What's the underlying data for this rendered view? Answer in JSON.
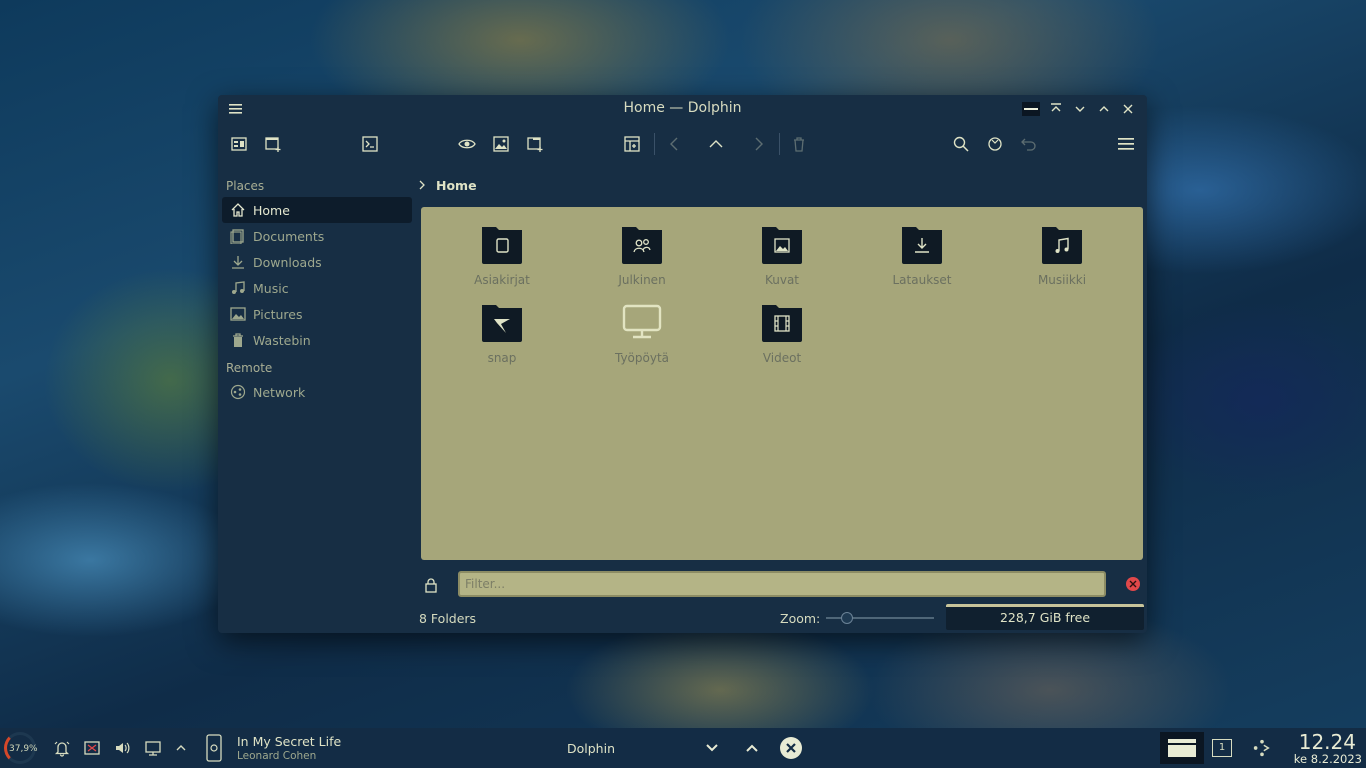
{
  "window": {
    "title": "Home — Dolphin"
  },
  "sidebar": {
    "places_title": "Places",
    "remote_title": "Remote",
    "places": [
      {
        "label": "Home",
        "icon": "home-icon"
      },
      {
        "label": "Documents",
        "icon": "documents-icon"
      },
      {
        "label": "Downloads",
        "icon": "downloads-icon"
      },
      {
        "label": "Music",
        "icon": "music-icon"
      },
      {
        "label": "Pictures",
        "icon": "pictures-icon"
      },
      {
        "label": "Wastebin",
        "icon": "trash-icon"
      }
    ],
    "remote": [
      {
        "label": "Network",
        "icon": "network-icon"
      }
    ]
  },
  "breadcrumb": {
    "current": "Home"
  },
  "folders": [
    {
      "label": "Asiakirjat",
      "icon": "documents-folder-icon"
    },
    {
      "label": "Julkinen",
      "icon": "public-folder-icon"
    },
    {
      "label": "Kuvat",
      "icon": "pictures-folder-icon"
    },
    {
      "label": "Lataukset",
      "icon": "downloads-folder-icon"
    },
    {
      "label": "Musiikki",
      "icon": "music-folder-icon"
    },
    {
      "label": "snap",
      "icon": "snap-folder-icon"
    },
    {
      "label": "Työpöytä",
      "icon": "desktop-folder-icon"
    },
    {
      "label": "Videot",
      "icon": "videos-folder-icon"
    }
  ],
  "filter": {
    "placeholder": "Filter..."
  },
  "statusbar": {
    "summary": "8 Folders",
    "zoom_label": "Zoom:",
    "free_space": "228,7 GiB free"
  },
  "taskbar": {
    "cpu_load": "37,9%",
    "media_title": "In My Secret Life",
    "media_artist": "Leonard Cohen",
    "task_title": "Dolphin",
    "desktop_number": "1",
    "clock_time": "12.24",
    "clock_date": "ke 8.2.2023"
  },
  "colors": {
    "window_bg": "#172e44",
    "content_bg": "#a6a67a",
    "accent": "#d8dcc0",
    "close_red": "#e0484a"
  }
}
